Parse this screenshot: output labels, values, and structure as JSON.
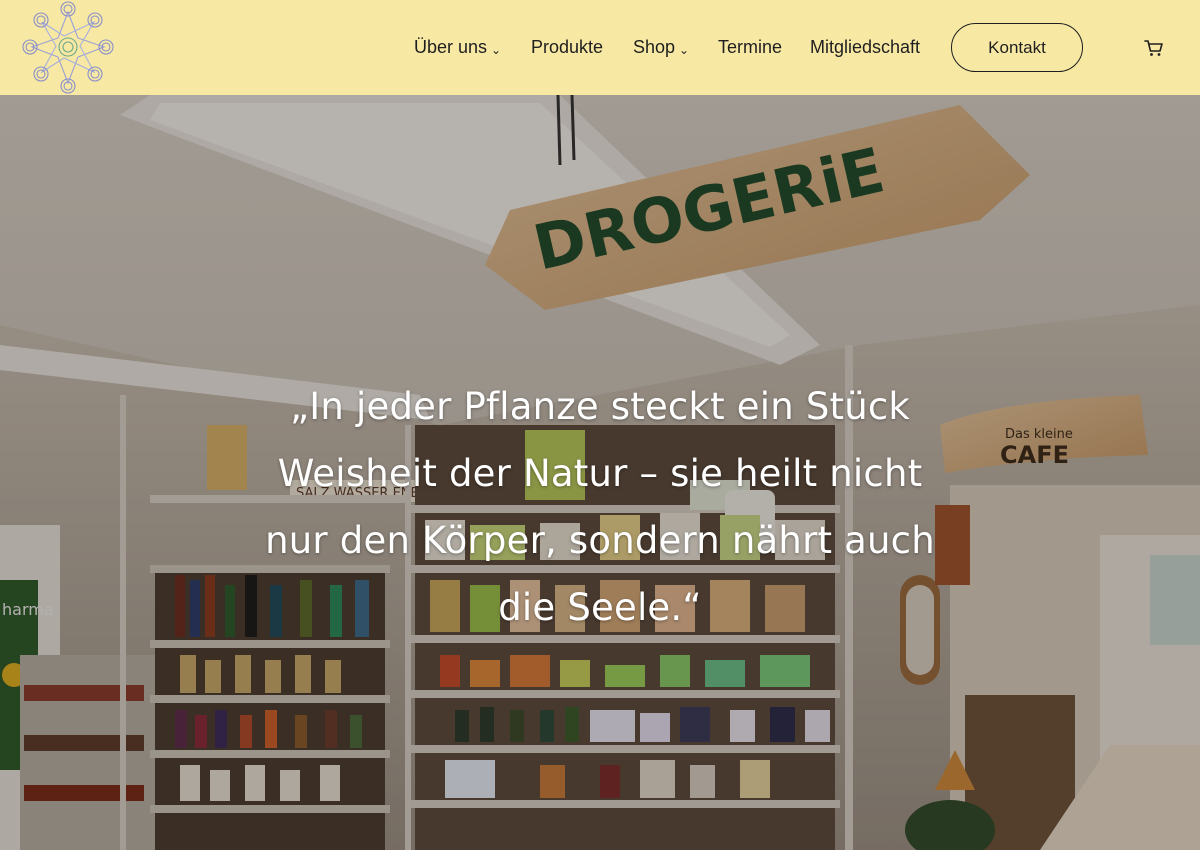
{
  "header": {
    "logo_name": "mandala-logo",
    "nav": [
      {
        "label": "Über uns",
        "has_dropdown": true
      },
      {
        "label": "Produkte",
        "has_dropdown": false
      },
      {
        "label": "Shop",
        "has_dropdown": true
      },
      {
        "label": "Termine",
        "has_dropdown": false
      },
      {
        "label": "Mitgliedschaft",
        "has_dropdown": false
      }
    ],
    "contact_label": "Kontakt",
    "cart_icon": "cart-icon",
    "dropdown_glyph": "⌄"
  },
  "hero": {
    "quote": "„In jeder Pflanze steckt ein Stück Weisheit der Natur – sie heilt nicht nur den Körper, sondern nährt auch die Seele.“",
    "sign_text": "DROGERiE",
    "cafe_sign_small": "Das kleine",
    "cafe_sign_large": "CAFE",
    "shelf_label": "SALZ WASSER ENERG",
    "side_label": "harma"
  },
  "colors": {
    "header_bg": "#f7e8a4",
    "text": "#1f1f1f",
    "quote_text": "#ffffff"
  }
}
